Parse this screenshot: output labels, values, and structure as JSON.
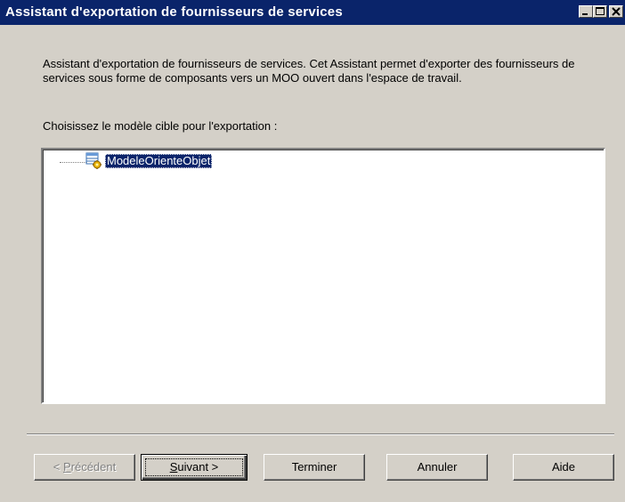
{
  "window": {
    "title": "Assistant d'exportation de fournisseurs de services",
    "controls": [
      "minimize-icon",
      "maximize-icon",
      "close-icon"
    ]
  },
  "intro_text": "Assistant d'exportation de fournisseurs de services. Cet Assistant permet d'exporter des fournisseurs de services sous forme de composants vers un MOO ouvert dans l'espace de travail.",
  "prompt": "Choisissez le modèle cible pour l'exportation :",
  "tree": {
    "items": [
      {
        "label": "ModeleOrienteObjet",
        "icon": "object-model-icon",
        "selected": true
      }
    ]
  },
  "buttons": {
    "previous": {
      "prefix": "< ",
      "accel": "P",
      "rest": "récédent",
      "enabled": false
    },
    "next": {
      "accel": "S",
      "rest": "uivant >",
      "enabled": true,
      "default": true
    },
    "finish": {
      "label": "Terminer"
    },
    "cancel": {
      "label": "Annuler"
    },
    "help": {
      "label": "Aide"
    }
  },
  "colors": {
    "titlebar": "#0a246a",
    "face": "#d4d0c8",
    "selection": "#0a246a"
  }
}
